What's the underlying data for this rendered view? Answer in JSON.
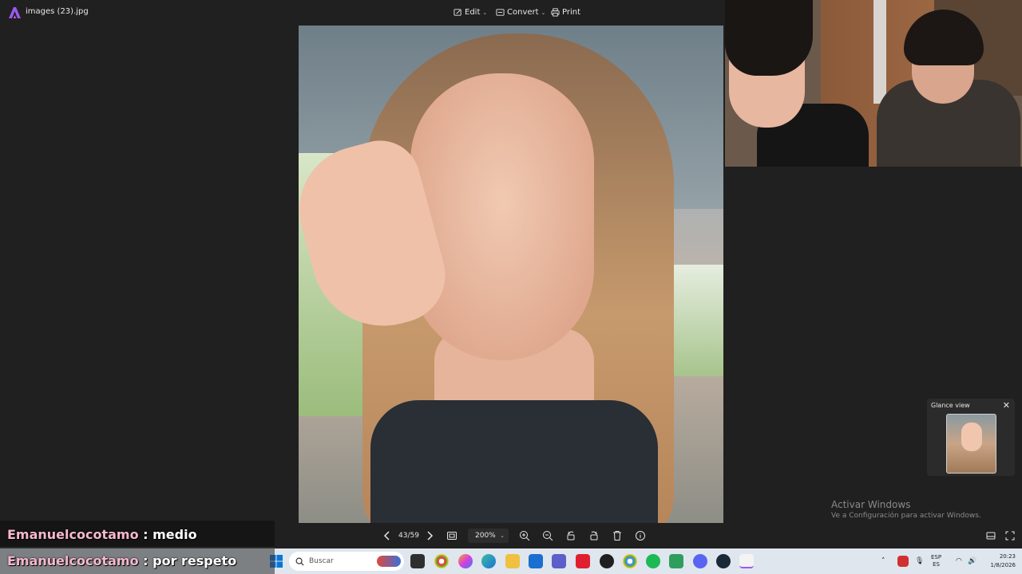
{
  "titlebar": {
    "file_name": "images (23).jpg",
    "edit_label": "Edit",
    "convert_label": "Convert",
    "print_label": "Print"
  },
  "toolbar": {
    "page_counter": "43/59",
    "zoom_value": "200%"
  },
  "glance": {
    "title": "Glance view",
    "close_glyph": "✕"
  },
  "watermark": {
    "line1": "Activar Windows",
    "line2": "Ve a Configuración para activar Windows."
  },
  "chat": [
    {
      "user": "Emanuelcocotamo",
      "separator": " : ",
      "message": "medio"
    },
    {
      "user": "Emanuelcocotamo",
      "separator": " : ",
      "message": "por respeto"
    }
  ],
  "taskbar": {
    "search_placeholder": "Buscar",
    "lang_top": "ESP",
    "lang_bottom": "ES",
    "time": "20:23",
    "date": "1/8/2026"
  },
  "colors": {
    "accent": "#9b59f0",
    "background": "#202020",
    "chat_user": "#f6b8cf"
  }
}
